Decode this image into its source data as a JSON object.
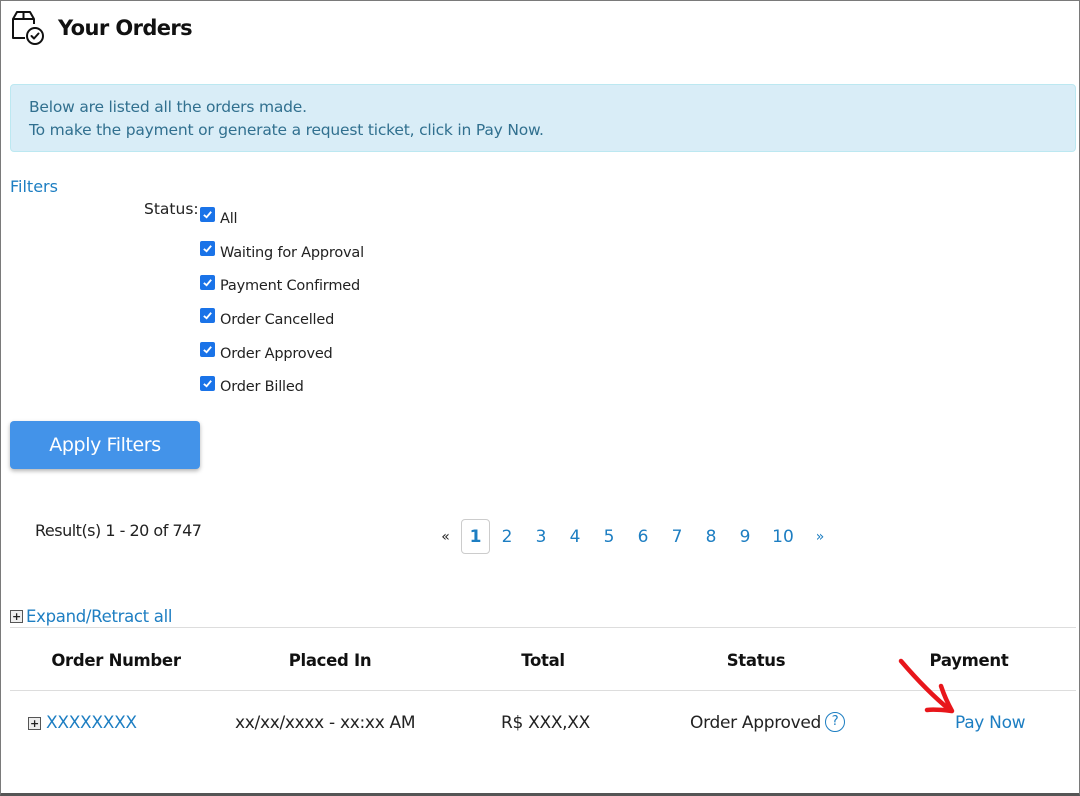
{
  "header": {
    "title": "Your Orders",
    "icon": "box-check-icon"
  },
  "alert": {
    "line1": "Below are listed all the orders made.",
    "line2": "To make the payment or generate a request ticket, click in Pay Now."
  },
  "filters": {
    "title": "Filters",
    "status_label": "Status:",
    "options": [
      {
        "label": "All",
        "checked": true
      },
      {
        "label": "Waiting for Approval",
        "checked": true
      },
      {
        "label": "Payment Confirmed",
        "checked": true
      },
      {
        "label": "Order Cancelled",
        "checked": true
      },
      {
        "label": "Order Approved",
        "checked": true
      },
      {
        "label": "Order Billed",
        "checked": true
      }
    ],
    "apply_label": "Apply Filters"
  },
  "results": {
    "text": "Result(s) 1 - 20 of 747"
  },
  "pagination": {
    "prev": "«",
    "pages": [
      "1",
      "2",
      "3",
      "4",
      "5",
      "6",
      "7",
      "8",
      "9",
      "10"
    ],
    "current": "1",
    "next": "»"
  },
  "expand": {
    "label": "Expand/Retract all",
    "icon": "plus-box-icon"
  },
  "table": {
    "headers": [
      "Order Number",
      "Placed In",
      "Total",
      "Status",
      "Payment"
    ],
    "rows": [
      {
        "order_number": "XXXXXXXX",
        "placed_in": "xx/xx/xxxx - xx:xx AM",
        "total": "R$ XXX,XX",
        "status": "Order Approved",
        "payment": "Pay Now"
      }
    ]
  },
  "colors": {
    "accent": "#1d7ec2",
    "button": "#4393e9",
    "alert_bg": "#d9edf7",
    "annotation": "#e8161b"
  }
}
